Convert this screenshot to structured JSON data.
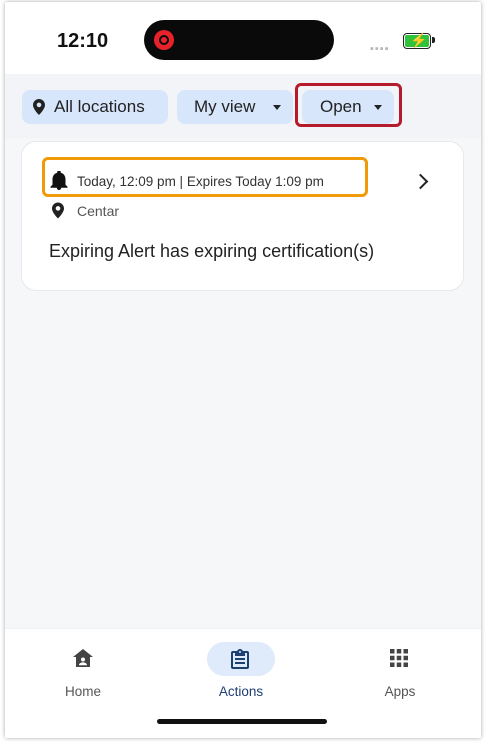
{
  "status_bar": {
    "time": "12:10"
  },
  "filters": {
    "locations_label": "All locations",
    "view_label": "My view",
    "status_label": "Open"
  },
  "alert_card": {
    "timestamp": "Today, 12:09 pm | Expires Today 1:09 pm",
    "location": "Centar",
    "title": "Expiring Alert has expiring certification(s)"
  },
  "bottom_nav": {
    "items": [
      {
        "label": "Home",
        "icon": "home-icon"
      },
      {
        "label": "Actions",
        "icon": "clipboard-icon",
        "active": true
      },
      {
        "label": "Apps",
        "icon": "grid-icon"
      }
    ]
  },
  "colors": {
    "chip_bg": "#d7e6fb",
    "active_nav": "#1d3f72",
    "highlight_red": "#b51b2a",
    "highlight_orange": "#ef9a06"
  }
}
